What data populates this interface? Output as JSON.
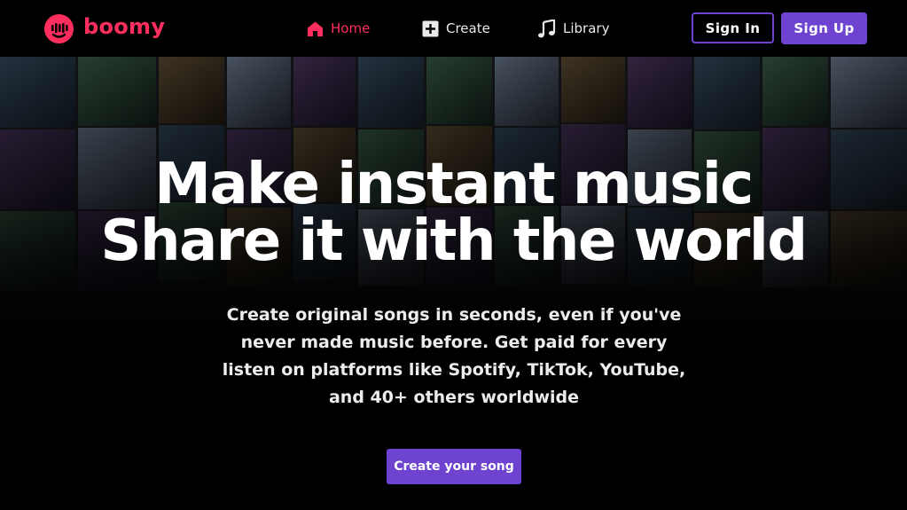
{
  "brand": {
    "name": "boomy",
    "color": "#ff2e5f"
  },
  "nav": {
    "items": [
      {
        "label": "Home",
        "icon": "home-icon",
        "active": true
      },
      {
        "label": "Create",
        "icon": "plus-square-icon",
        "active": false
      },
      {
        "label": "Library",
        "icon": "music-note-icon",
        "active": false
      }
    ],
    "sign_in_label": "Sign In",
    "sign_up_label": "Sign Up"
  },
  "hero": {
    "headline_line1": "Make instant music",
    "headline_line2": "Share it with the world",
    "subtitle": "Create original songs in seconds, even if you've never made music before. Get paid for every listen on platforms like Spotify, TikTok, YouTube, and 40+ others worldwide",
    "cta_label": "Create your song"
  },
  "colors": {
    "accent": "#6d43cf",
    "background": "#000000",
    "active_nav": "#ff2e5f"
  }
}
